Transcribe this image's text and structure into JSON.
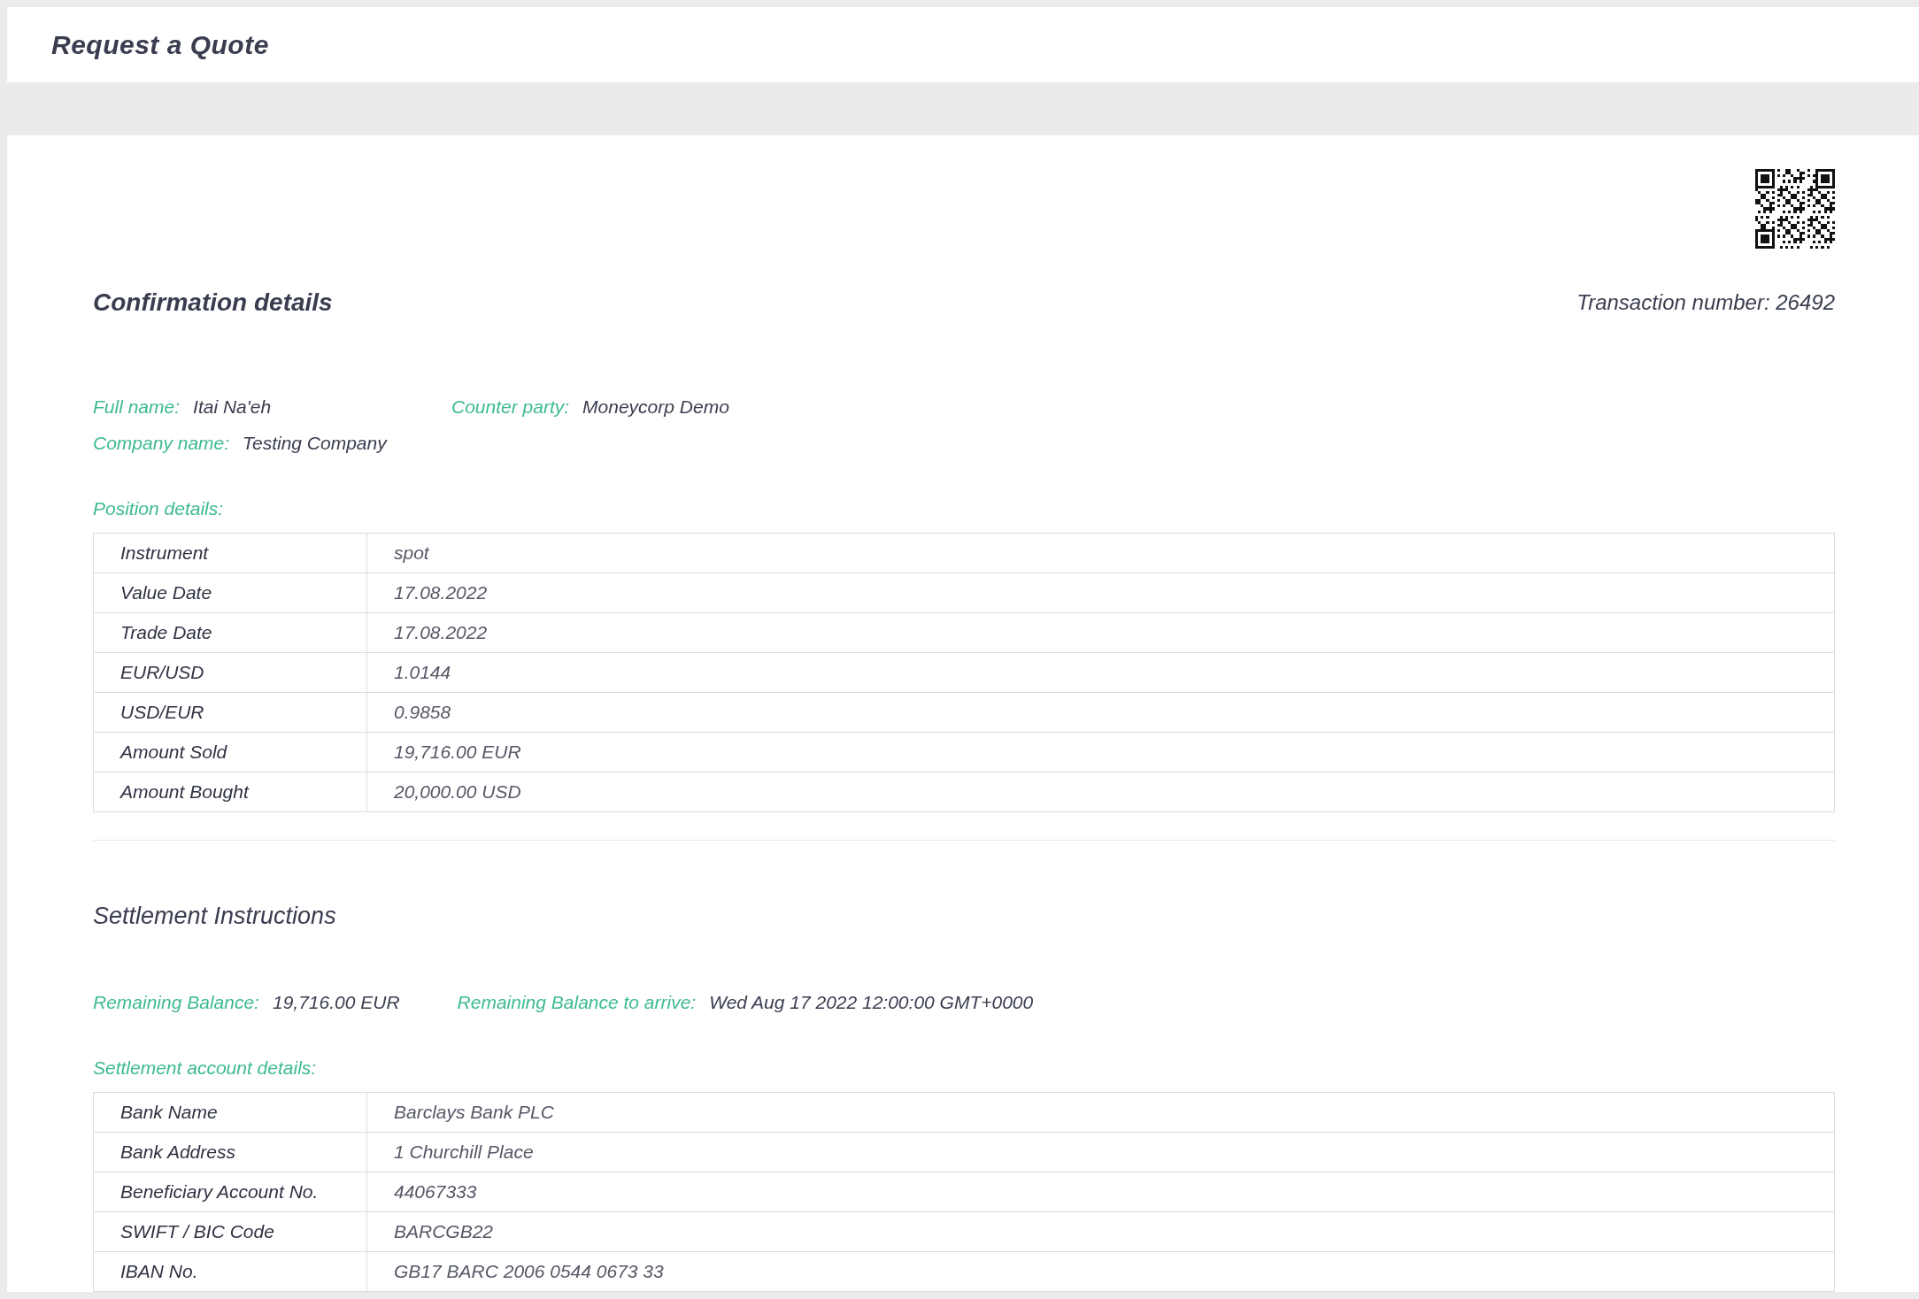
{
  "header": {
    "title": "Request a Quote"
  },
  "confirmation": {
    "title": "Confirmation details",
    "transaction_number": "Transaction number: 26492",
    "info_rows": [
      [
        {
          "label": "Full name:",
          "value": "Itai Na'eh"
        },
        {
          "label": "Counter party:",
          "value": "Moneycorp Demo"
        }
      ],
      [
        {
          "label": "Company name:",
          "value": "Testing Company"
        }
      ]
    ],
    "position_details": {
      "title": "Position details:",
      "rows": [
        {
          "label": "Instrument",
          "value": "spot"
        },
        {
          "label": "Value Date",
          "value": "17.08.2022"
        },
        {
          "label": "Trade Date",
          "value": "17.08.2022"
        },
        {
          "label": "EUR/USD",
          "value": "1.0144"
        },
        {
          "label": "USD/EUR",
          "value": "0.9858"
        },
        {
          "label": "Amount Sold",
          "value": "19,716.00 EUR"
        },
        {
          "label": "Amount Bought",
          "value": "20,000.00 USD"
        }
      ]
    }
  },
  "settlement": {
    "title": "Settlement Instructions",
    "balances": [
      {
        "label": "Remaining Balance:",
        "value": "19,716.00 EUR"
      },
      {
        "label": "Remaining Balance to arrive:",
        "value": "Wed Aug 17 2022 12:00:00 GMT+0000"
      }
    ],
    "account_details": {
      "title": "Settlement account details:",
      "rows": [
        {
          "label": "Bank Name",
          "value": "Barclays Bank PLC"
        },
        {
          "label": "Bank Address",
          "value": "1 Churchill Place"
        },
        {
          "label": "Beneficiary Account No.",
          "value": "44067333"
        },
        {
          "label": "SWIFT / BIC Code",
          "value": "BARCGB22"
        },
        {
          "label": "IBAN No.",
          "value": "GB17 BARC 2006 0544 0673 33"
        }
      ]
    }
  }
}
